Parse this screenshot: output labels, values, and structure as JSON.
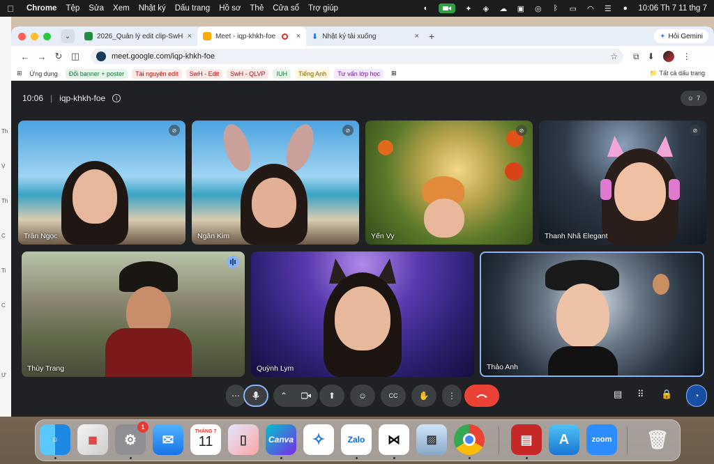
{
  "menubar": {
    "app": "Chrome",
    "items": [
      "Tệp",
      "Sửa",
      "Xem",
      "Nhật ký",
      "Dấu trang",
      "Hồ sơ",
      "Thẻ",
      "Cửa sổ",
      "Trợ giúp"
    ],
    "clock": "10:06 Th 7 11 thg 7"
  },
  "browser": {
    "tabs": [
      {
        "label": "2026_Quản lý edit clip-SwH",
        "color": "#1e8e3e"
      },
      {
        "label": "Meet - iqp-khkh-foe",
        "color": "#f9ab00"
      },
      {
        "label": "Nhật ký tải xuống",
        "color": "#1a73e8"
      }
    ],
    "gemini": "Hỏi Gemini",
    "url": "meet.google.com/iqp-khkh-foe",
    "bookmarks": [
      {
        "label": "Ứng dụng",
        "bg": "transparent",
        "fg": "#333"
      },
      {
        "label": "Đổi banner + poster",
        "bg": "#e6f4ea",
        "fg": "#137333"
      },
      {
        "label": "Tài nguyên edit",
        "bg": "#fce8e6",
        "fg": "#a50e0e"
      },
      {
        "label": "SwH - Edit",
        "bg": "#fce8e6",
        "fg": "#a50e0e"
      },
      {
        "label": "SwH - QLVP",
        "bg": "#fce8e6",
        "fg": "#a50e0e"
      },
      {
        "label": "IUH",
        "bg": "#e6f4ea",
        "fg": "#137333"
      },
      {
        "label": "Tiếng Anh",
        "bg": "#fef7e0",
        "fg": "#7a5c00"
      },
      {
        "label": "Tư vấn lớp học",
        "bg": "#f3e8fd",
        "fg": "#6a1b9a"
      }
    ],
    "all_bookmarks": "Tất cả dấu trang"
  },
  "meet": {
    "time": "10:06",
    "code": "iqp-khkh-foe",
    "participant_count": "7",
    "participants": [
      {
        "name": "Trần Ngọc",
        "muted": true
      },
      {
        "name": "Ngân Kim",
        "muted": true
      },
      {
        "name": "Yến Vy",
        "muted": true
      },
      {
        "name": "Thanh Nhã Elegant",
        "muted": true
      },
      {
        "name": "Thùy Trang",
        "speaking": true
      },
      {
        "name": "Quỳnh Lym"
      },
      {
        "name": "Thảo Anh"
      }
    ]
  },
  "dock": {
    "apps": [
      "Finder",
      "Launchpad",
      "System Settings",
      "Mail",
      "Calendar",
      "iPhone Mirroring",
      "Canva",
      "Safari",
      "Zalo",
      "CapCut",
      "Preview",
      "Chrome",
      "Photo Booth",
      "App Store",
      "Zoom",
      "Trash"
    ],
    "calendar_month": "THÁNG 7",
    "calendar_day": "11",
    "settings_badge": "1"
  },
  "colors": {
    "accent": "#8ab4f8",
    "end_call": "#ea4335",
    "meet_bg": "#202124"
  }
}
